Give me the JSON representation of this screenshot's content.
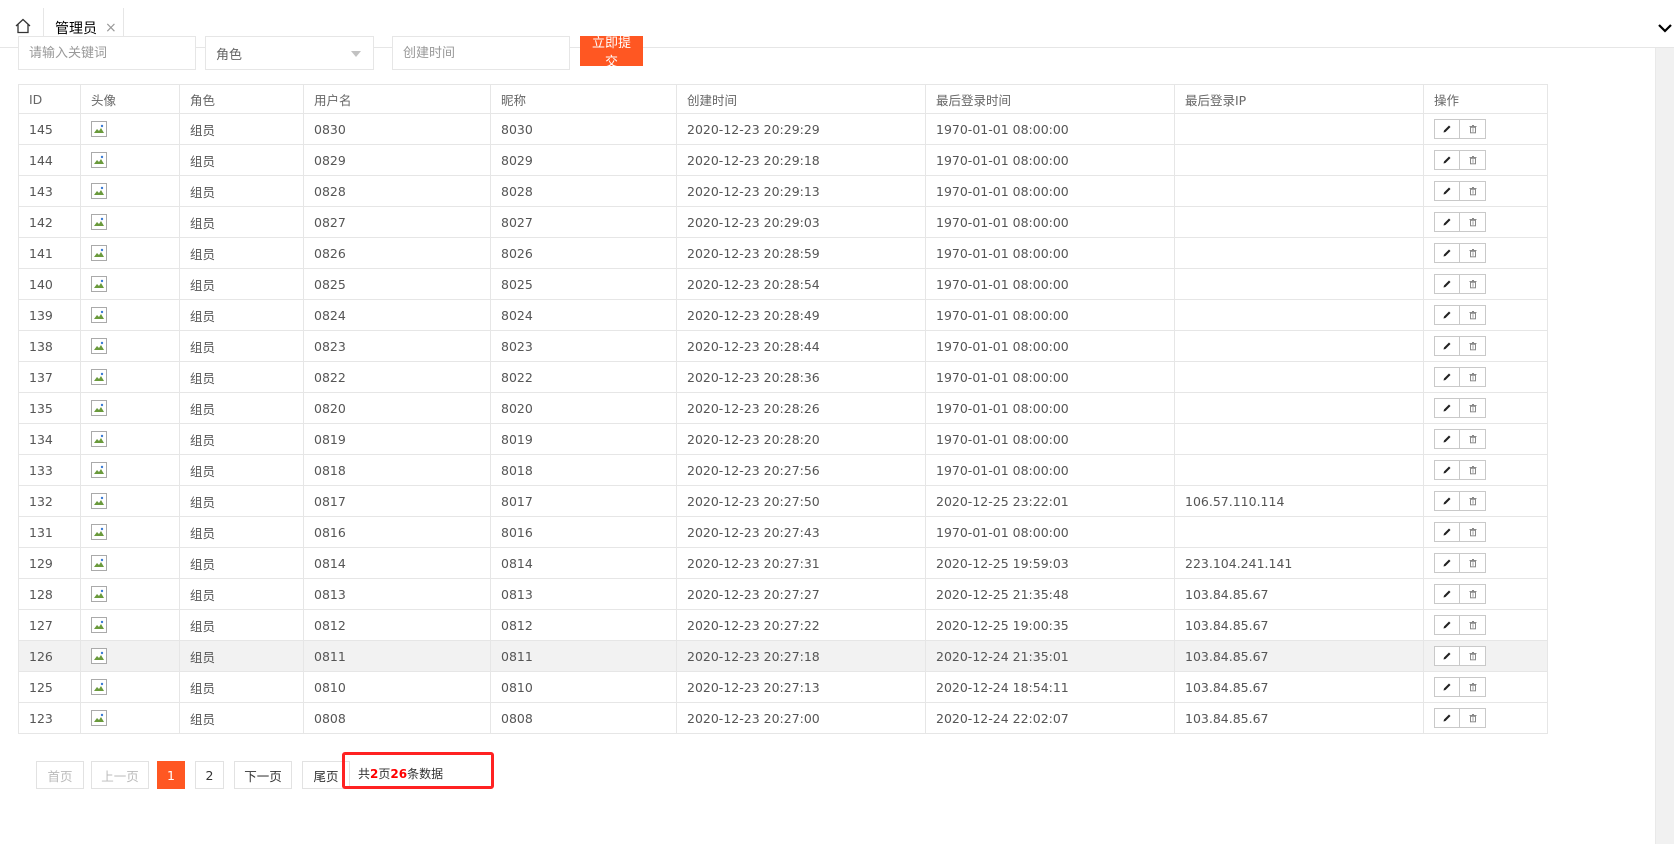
{
  "tabs": {
    "active_tab": "管理员",
    "close_glyph": "×"
  },
  "filters": {
    "keyword_placeholder": "请输入关键词",
    "role_select_value": "角色",
    "created_time_placeholder": "创建时间",
    "submit_label": "立即提交"
  },
  "table": {
    "headers": [
      "ID",
      "头像",
      "角色",
      "用户名",
      "昵称",
      "创建时间",
      "最后登录时间",
      "最后登录IP",
      "操作"
    ],
    "rows": [
      {
        "id": "145",
        "role": "组员",
        "username": "0830",
        "nickname": "8030",
        "created": "2020-12-23 20:29:29",
        "last_login": "1970-01-01 08:00:00",
        "ip": ""
      },
      {
        "id": "144",
        "role": "组员",
        "username": "0829",
        "nickname": "8029",
        "created": "2020-12-23 20:29:18",
        "last_login": "1970-01-01 08:00:00",
        "ip": ""
      },
      {
        "id": "143",
        "role": "组员",
        "username": "0828",
        "nickname": "8028",
        "created": "2020-12-23 20:29:13",
        "last_login": "1970-01-01 08:00:00",
        "ip": ""
      },
      {
        "id": "142",
        "role": "组员",
        "username": "0827",
        "nickname": "8027",
        "created": "2020-12-23 20:29:03",
        "last_login": "1970-01-01 08:00:00",
        "ip": ""
      },
      {
        "id": "141",
        "role": "组员",
        "username": "0826",
        "nickname": "8026",
        "created": "2020-12-23 20:28:59",
        "last_login": "1970-01-01 08:00:00",
        "ip": ""
      },
      {
        "id": "140",
        "role": "组员",
        "username": "0825",
        "nickname": "8025",
        "created": "2020-12-23 20:28:54",
        "last_login": "1970-01-01 08:00:00",
        "ip": ""
      },
      {
        "id": "139",
        "role": "组员",
        "username": "0824",
        "nickname": "8024",
        "created": "2020-12-23 20:28:49",
        "last_login": "1970-01-01 08:00:00",
        "ip": ""
      },
      {
        "id": "138",
        "role": "组员",
        "username": "0823",
        "nickname": "8023",
        "created": "2020-12-23 20:28:44",
        "last_login": "1970-01-01 08:00:00",
        "ip": ""
      },
      {
        "id": "137",
        "role": "组员",
        "username": "0822",
        "nickname": "8022",
        "created": "2020-12-23 20:28:36",
        "last_login": "1970-01-01 08:00:00",
        "ip": ""
      },
      {
        "id": "135",
        "role": "组员",
        "username": "0820",
        "nickname": "8020",
        "created": "2020-12-23 20:28:26",
        "last_login": "1970-01-01 08:00:00",
        "ip": ""
      },
      {
        "id": "134",
        "role": "组员",
        "username": "0819",
        "nickname": "8019",
        "created": "2020-12-23 20:28:20",
        "last_login": "1970-01-01 08:00:00",
        "ip": ""
      },
      {
        "id": "133",
        "role": "组员",
        "username": "0818",
        "nickname": "8018",
        "created": "2020-12-23 20:27:56",
        "last_login": "1970-01-01 08:00:00",
        "ip": ""
      },
      {
        "id": "132",
        "role": "组员",
        "username": "0817",
        "nickname": "8017",
        "created": "2020-12-23 20:27:50",
        "last_login": "2020-12-25 23:22:01",
        "ip": "106.57.110.114"
      },
      {
        "id": "131",
        "role": "组员",
        "username": "0816",
        "nickname": "8016",
        "created": "2020-12-23 20:27:43",
        "last_login": "1970-01-01 08:00:00",
        "ip": ""
      },
      {
        "id": "129",
        "role": "组员",
        "username": "0814",
        "nickname": "0814",
        "created": "2020-12-23 20:27:31",
        "last_login": "2020-12-25 19:59:03",
        "ip": "223.104.241.141"
      },
      {
        "id": "128",
        "role": "组员",
        "username": "0813",
        "nickname": "0813",
        "created": "2020-12-23 20:27:27",
        "last_login": "2020-12-25 21:35:48",
        "ip": "103.84.85.67"
      },
      {
        "id": "127",
        "role": "组员",
        "username": "0812",
        "nickname": "0812",
        "created": "2020-12-23 20:27:22",
        "last_login": "2020-12-25 19:00:35",
        "ip": "103.84.85.67"
      },
      {
        "id": "126",
        "role": "组员",
        "username": "0811",
        "nickname": "0811",
        "created": "2020-12-23 20:27:18",
        "last_login": "2020-12-24 21:35:01",
        "ip": "103.84.85.67",
        "hover": true
      },
      {
        "id": "125",
        "role": "组员",
        "username": "0810",
        "nickname": "0810",
        "created": "2020-12-23 20:27:13",
        "last_login": "2020-12-24 18:54:11",
        "ip": "103.84.85.67"
      },
      {
        "id": "123",
        "role": "组员",
        "username": "0808",
        "nickname": "0808",
        "created": "2020-12-23 20:27:00",
        "last_login": "2020-12-24 22:02:07",
        "ip": "103.84.85.67"
      }
    ]
  },
  "pagination": {
    "first": "首页",
    "prev": "上一页",
    "page1": "1",
    "page2": "2",
    "next": "下一页",
    "last": "尾页",
    "summary_prefix": "共",
    "total_pages": "2",
    "summary_mid": "页",
    "total_records": "26",
    "summary_suffix": "条数据"
  },
  "icons": {
    "home": "home-icon",
    "close": "close-icon",
    "chevron": "chevron-down-icon",
    "edit": "pencil-icon",
    "delete": "trash-icon",
    "avatar": "broken-image-icon"
  },
  "colors": {
    "accent": "#ff5722",
    "highlight_box": "#ff2222",
    "summary_number": "#ff0000"
  }
}
